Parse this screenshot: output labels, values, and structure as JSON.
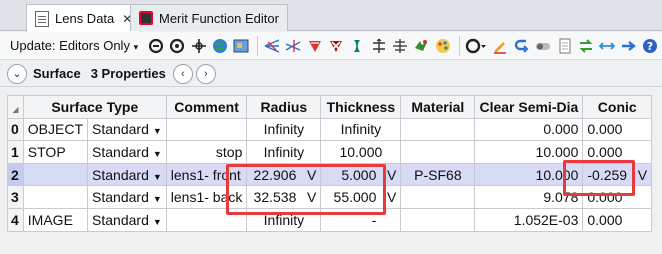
{
  "tabs": [
    {
      "label": "Lens Data",
      "close": "✕"
    },
    {
      "label": "Merit Function Editor"
    }
  ],
  "toolbar": {
    "update_label": "Update: Editors Only",
    "update_caret": "▾"
  },
  "surface_bar": {
    "collapse_glyph": "⌄",
    "title": "Surface",
    "properties": "3 Properties",
    "prev_glyph": "‹",
    "next_glyph": "›"
  },
  "table": {
    "headers": [
      "Surface Type",
      "Comment",
      "Radius",
      "Thickness",
      "Material",
      "Clear Semi-Dia",
      "Conic"
    ],
    "rows": [
      {
        "num": "0",
        "name": "OBJECT",
        "type": "Standard",
        "comment": "",
        "radius": "Infinity",
        "radius_flag": "",
        "thickness": "Infinity",
        "thickness_flag": "",
        "material": "",
        "semidia": "0.000",
        "conic": "0.000",
        "conic_flag": ""
      },
      {
        "num": "1",
        "name": "STOP",
        "type": "Standard",
        "comment": "stop",
        "radius": "Infinity",
        "radius_flag": "",
        "thickness": "10.000",
        "thickness_flag": "",
        "material": "",
        "semidia": "10.000",
        "conic": "0.000",
        "conic_flag": ""
      },
      {
        "num": "2",
        "name": "",
        "type": "Standard",
        "comment": "lens1- front",
        "radius": "22.906",
        "radius_flag": "V",
        "thickness": "5.000",
        "thickness_flag": "V",
        "material": "P-SF68",
        "semidia": "10.000",
        "conic": "-0.259",
        "conic_flag": "V"
      },
      {
        "num": "3",
        "name": "",
        "type": "Standard",
        "comment": "lens1- back",
        "radius": "32.538",
        "radius_flag": "V",
        "thickness": "55.000",
        "thickness_flag": "V",
        "material": "",
        "semidia": "9.078",
        "conic": "0.000",
        "conic_flag": ""
      },
      {
        "num": "4",
        "name": "IMAGE",
        "type": "Standard",
        "comment": "",
        "radius": "Infinity",
        "radius_flag": "",
        "thickness": "-",
        "thickness_flag": "",
        "material": "",
        "semidia": "1.052E-03",
        "conic": "0.000",
        "conic_flag": ""
      }
    ]
  },
  "selected_row": 2,
  "highlight_color": "#e8393c",
  "selection_color": "#d7dbf6"
}
